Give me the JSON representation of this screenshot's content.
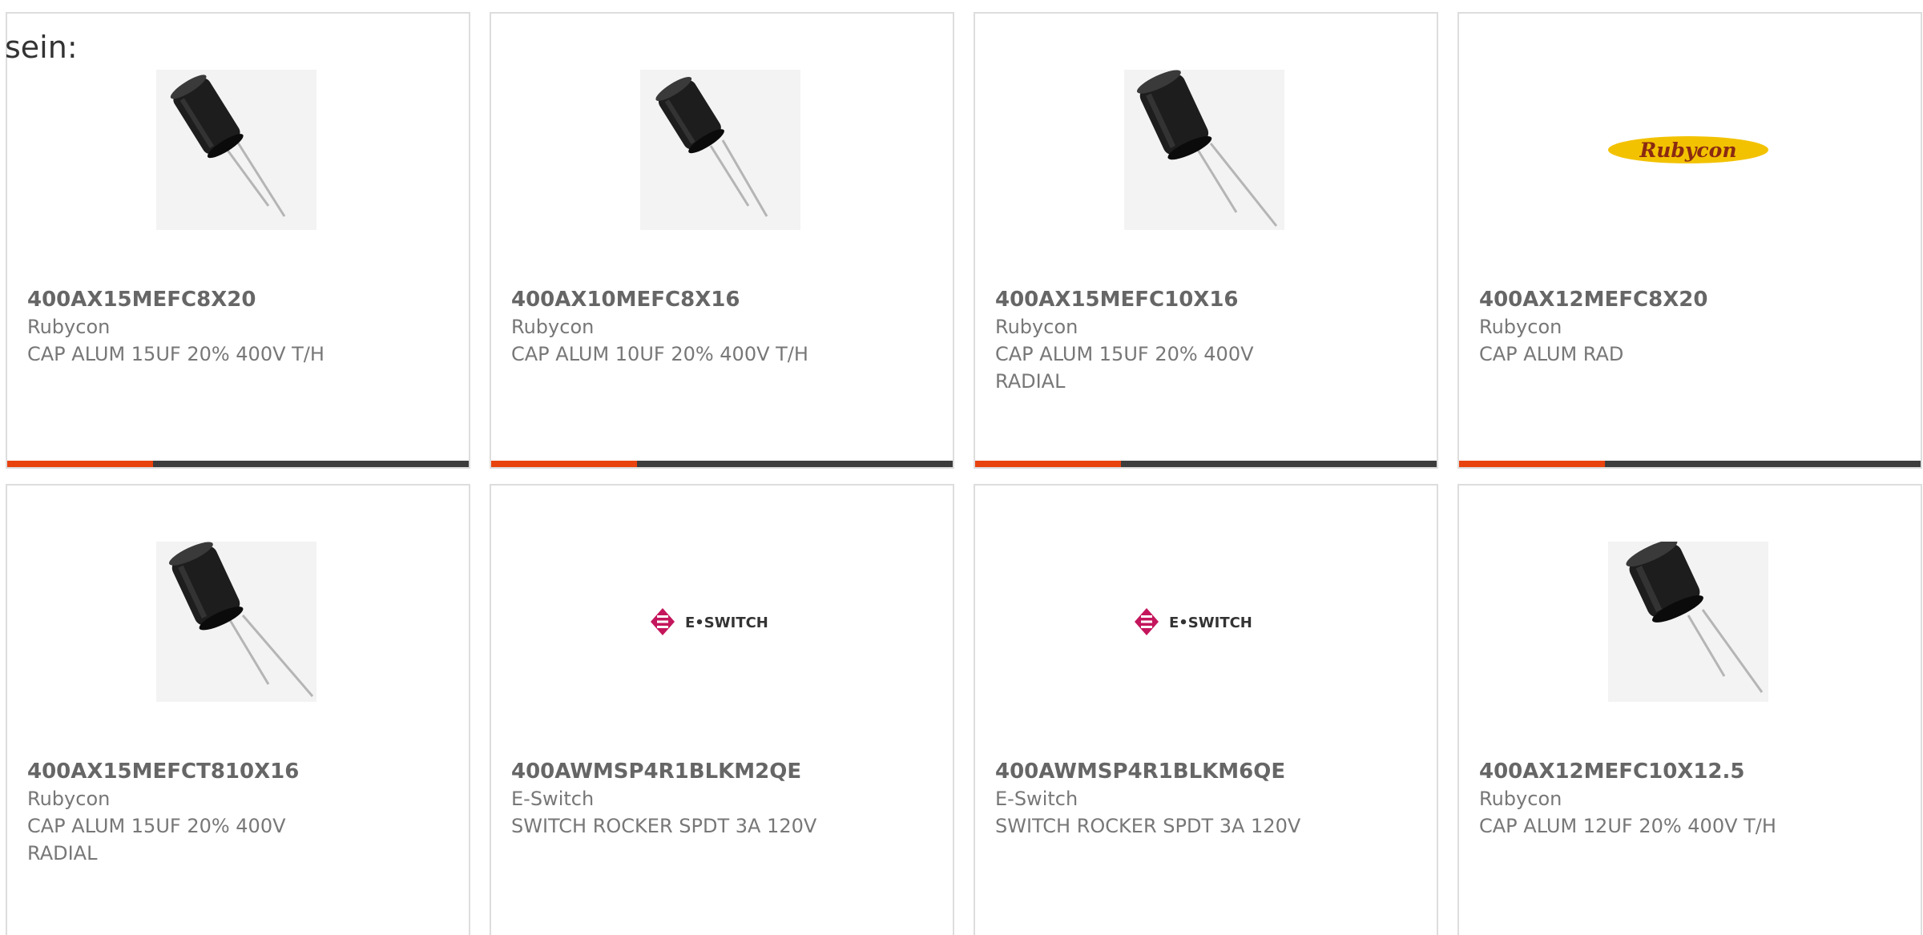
{
  "intro_text": "sein:",
  "colors": {
    "accent": "#e8430f",
    "bar_dark": "#3c3c3c",
    "rubycon_logo_fill": "#f2c200",
    "eswitch_brand": "#c4165c"
  },
  "products": [
    {
      "part_number": "400AX15MEFC8X20",
      "manufacturer": "Rubycon",
      "description": "CAP ALUM 15UF 20% 400V T/H",
      "image_icon": "electrolytic-capacitor-icon"
    },
    {
      "part_number": "400AX10MEFC8X16",
      "manufacturer": "Rubycon",
      "description": "CAP ALUM 10UF 20% 400V T/H",
      "image_icon": "electrolytic-capacitor-icon"
    },
    {
      "part_number": "400AX15MEFC10X16",
      "manufacturer": "Rubycon",
      "description": "CAP ALUM 15UF 20% 400V RADIAL",
      "image_icon": "electrolytic-capacitor-icon"
    },
    {
      "part_number": "400AX12MEFC8X20",
      "manufacturer": "Rubycon",
      "description": "CAP ALUM RAD",
      "image_icon": "rubycon-logo",
      "logo_text": "Rubycon"
    },
    {
      "part_number": "400AX15MEFCT810X16",
      "manufacturer": "Rubycon",
      "description": "CAP ALUM 15UF 20% 400V RADIAL",
      "image_icon": "electrolytic-capacitor-icon"
    },
    {
      "part_number": "400AWMSP4R1BLKM2QE",
      "manufacturer": "E-Switch",
      "description": "SWITCH ROCKER SPDT 3A 120V",
      "image_icon": "e-switch-logo",
      "logo_text": "E•SWITCH"
    },
    {
      "part_number": "400AWMSP4R1BLKM6QE",
      "manufacturer": "E-Switch",
      "description": "SWITCH ROCKER SPDT 3A 120V",
      "image_icon": "e-switch-logo",
      "logo_text": "E•SWITCH"
    },
    {
      "part_number": "400AX12MEFC10X12.5",
      "manufacturer": "Rubycon",
      "description": "CAP ALUM 12UF 20% 400V T/H",
      "image_icon": "electrolytic-capacitor-icon"
    }
  ]
}
